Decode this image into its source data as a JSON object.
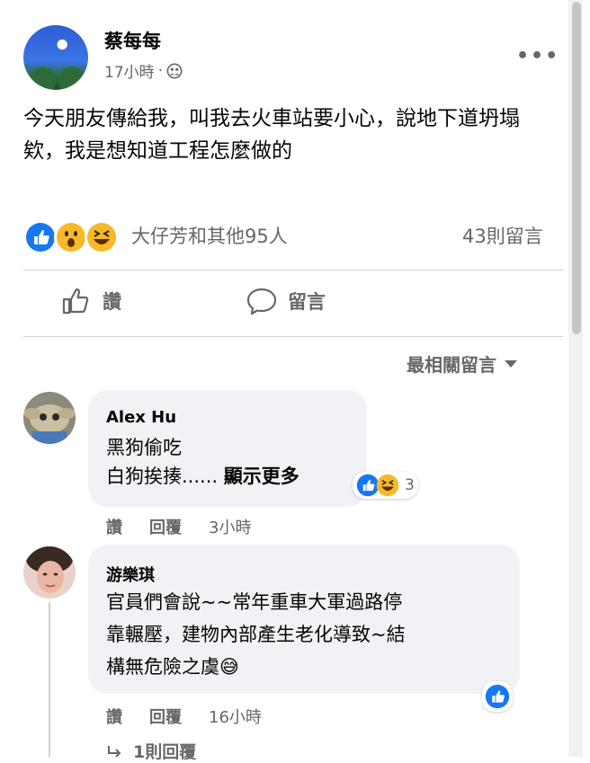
{
  "post": {
    "author": "蔡每每",
    "time": "17小時",
    "separator": "·",
    "privacy_icon": "friends-icon",
    "more_label": "•••",
    "text": "今天朋友傳給我，叫我去火車站要小心，說地下道坍塌欸，我是想知道工程怎麼做的",
    "reaction_icons": [
      "like-icon",
      "wow-icon",
      "haha-icon"
    ],
    "reaction_names": "大仔芳和其他95人",
    "comment_count": "43則留言"
  },
  "actions": {
    "like_label": "讚",
    "comment_label": "留言"
  },
  "sort": {
    "label": "最相關留言"
  },
  "comments": [
    {
      "name": "Alex Hu",
      "line1": "黑狗偷吃",
      "line2": "白狗挨揍......",
      "see_more": "顯示更多",
      "reaction_count": "3",
      "like": "讚",
      "reply": "回覆",
      "time": "3小時"
    },
    {
      "name": "游樂琪",
      "line1": "官員們會說~~常年重車大軍過路停",
      "line2": "靠輾壓，建物內部產生老化導致~結",
      "line3": "構無危險之虞",
      "emoji": "😅",
      "like": "讚",
      "reply": "回覆",
      "time": "16小時",
      "replies": "1則回覆"
    }
  ],
  "colors": {
    "like_blue": "#1877f2",
    "reaction_yellow": "#f7b928",
    "muted_text": "#65676b",
    "bubble_bg": "#f0f2f5"
  }
}
